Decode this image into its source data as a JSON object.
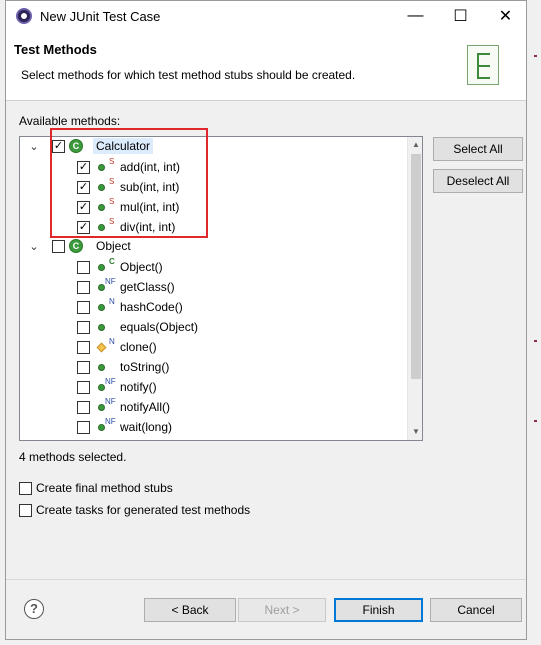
{
  "window": {
    "title": "New JUnit Test Case"
  },
  "titlebar": {
    "minimize": "—",
    "maximize": "☐",
    "close": "✕"
  },
  "header": {
    "title": "Test Methods",
    "description": "Select methods for which test method stubs should be created."
  },
  "tree": {
    "label": "Available methods:",
    "groups": [
      {
        "name": "Calculator",
        "expanded": true,
        "checked": true,
        "icon": "class-icon",
        "methods": [
          {
            "name": "add(int, int)",
            "checked": true,
            "modifier": "S",
            "visibility": "public"
          },
          {
            "name": "sub(int, int)",
            "checked": true,
            "modifier": "S",
            "visibility": "public"
          },
          {
            "name": "mul(int, int)",
            "checked": true,
            "modifier": "S",
            "visibility": "public"
          },
          {
            "name": "div(int, int)",
            "checked": true,
            "modifier": "S",
            "visibility": "public"
          }
        ]
      },
      {
        "name": "Object",
        "expanded": true,
        "checked": false,
        "icon": "class-icon",
        "methods": [
          {
            "name": "Object()",
            "checked": false,
            "modifier": "C",
            "visibility": "public"
          },
          {
            "name": "getClass()",
            "checked": false,
            "modifier": "NF",
            "visibility": "public"
          },
          {
            "name": "hashCode()",
            "checked": false,
            "modifier": "N",
            "visibility": "public"
          },
          {
            "name": "equals(Object)",
            "checked": false,
            "modifier": "",
            "visibility": "public"
          },
          {
            "name": "clone()",
            "checked": false,
            "modifier": "N",
            "visibility": "protected"
          },
          {
            "name": "toString()",
            "checked": false,
            "modifier": "",
            "visibility": "public"
          },
          {
            "name": "notify()",
            "checked": false,
            "modifier": "NF",
            "visibility": "public"
          },
          {
            "name": "notifyAll()",
            "checked": false,
            "modifier": "NF",
            "visibility": "public"
          },
          {
            "name": "wait(long)",
            "checked": false,
            "modifier": "NF",
            "visibility": "public"
          }
        ]
      }
    ]
  },
  "buttons": {
    "select_all": "Select All",
    "deselect_all": "Deselect All",
    "back": "< Back",
    "next": "Next >",
    "finish": "Finish",
    "cancel": "Cancel"
  },
  "status": "4 methods selected.",
  "options": {
    "final_stubs": {
      "label": "Create final method stubs",
      "checked": false
    },
    "tasks": {
      "label": "Create tasks for generated test methods",
      "checked": false
    }
  },
  "colors": {
    "highlight_border": "#e0282a",
    "method_icon": "#3a9a3a",
    "static_modifier": "#c0392b",
    "selection_bg": "#dcecfc"
  }
}
